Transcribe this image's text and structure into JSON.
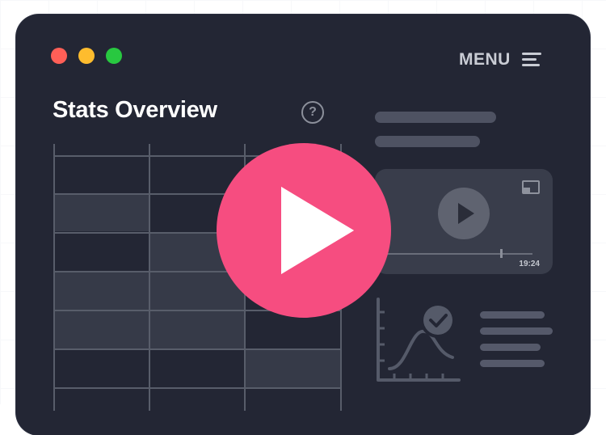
{
  "window": {
    "controls": [
      "close",
      "minimize",
      "maximize"
    ]
  },
  "header": {
    "menu_label": "MENU",
    "menu_icon": "hamburger-icon"
  },
  "main": {
    "title": "Stats Overview",
    "help_icon_text": "?"
  },
  "video": {
    "time": "19:24",
    "progress": 0.78
  },
  "overlay": {
    "play_icon": "play-icon"
  },
  "colors": {
    "window_bg": "#232634",
    "accent_pink": "#f64d80",
    "close": "#ff5f57",
    "minimize": "#febc2e",
    "maximize": "#28c840"
  }
}
